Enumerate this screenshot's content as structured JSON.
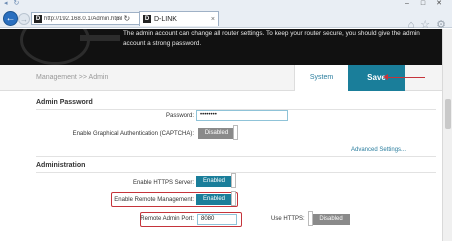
{
  "browser": {
    "url": "http://192.168.0.1/Admin.html",
    "tab_title": "D-LINK",
    "favicon_letter": "D",
    "tab_close": "×",
    "back": "←",
    "forward": "→",
    "search_glyph": "⌕",
    "refresh_glyph": "↻",
    "minimize": "–",
    "maximize": "□",
    "close": "✕",
    "home_glyph": "⌂",
    "star_glyph": "☆",
    "gear_glyph": "⚙"
  },
  "banner": {
    "text": "The admin account can change all router settings. To keep your router secure, you should give the admin account a strong password."
  },
  "header": {
    "breadcrumb": "Management >> Admin",
    "system_tab": "System",
    "save_label": "Save"
  },
  "admin_password": {
    "title": "Admin Password",
    "password_label": "Password:",
    "password_value": "••••••••",
    "captcha_label": "Enable Graphical Authentication (CAPTCHA):",
    "captcha_state": "Disabled",
    "advanced_link": "Advanced Settings..."
  },
  "administration": {
    "title": "Administration",
    "https_label": "Enable HTTPS Server:",
    "https_state": "Enabled",
    "remote_label": "Enable Remote Management:",
    "remote_state": "Enabled",
    "port_label": "Remote Admin Port:",
    "port_value": "8080",
    "use_https_label": "Use HTTPS:",
    "use_https_state": "Disabled"
  },
  "colors": {
    "accent": "#1a7e9a",
    "highlight": "#c5343b"
  }
}
